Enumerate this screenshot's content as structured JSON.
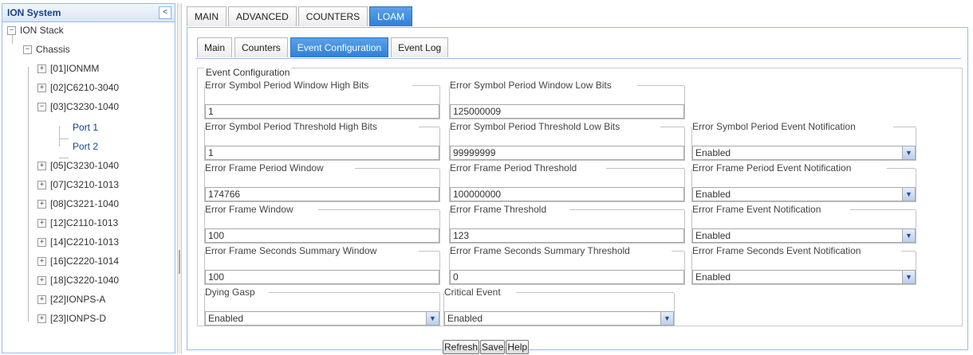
{
  "tree": {
    "title": "ION System",
    "collapse_icon": "<",
    "root": "ION Stack",
    "chassis": "Chassis",
    "items": [
      "[01]IONMM",
      "[02]C6210-3040",
      "[03]C3230-1040",
      "Port 1",
      "Port 2",
      "[05]C3230-1040",
      "[07]C3210-1013",
      "[08]C3221-1040",
      "[12]C2110-1013",
      "[14]C2210-1013",
      "[16]C2220-1014",
      "[18]C3220-1040",
      "[22]IONPS-A",
      "[23]IONPS-D"
    ],
    "expand_glyph": "+",
    "collapse_glyph": "−"
  },
  "main_tabs": [
    "MAIN",
    "ADVANCED",
    "COUNTERS",
    "LOAM"
  ],
  "sub_tabs": [
    "Main",
    "Counters",
    "Event Configuration",
    "Event Log"
  ],
  "event": {
    "legend": "Event Configuration",
    "fields": {
      "esp_window_high": {
        "label": "Error Symbol Period Window High Bits",
        "value": "1"
      },
      "esp_window_low": {
        "label": "Error Symbol Period Window Low Bits",
        "value": "125000009"
      },
      "esp_threshold_high": {
        "label": "Error Symbol Period Threshold High Bits",
        "value": "1"
      },
      "esp_threshold_low": {
        "label": "Error Symbol Period Threshold Low Bits",
        "value": "99999999"
      },
      "esp_notification": {
        "label": "Error Symbol Period Event Notification",
        "value": "Enabled"
      },
      "efp_window": {
        "label": "Error Frame Period Window",
        "value": "174766"
      },
      "efp_threshold": {
        "label": "Error Frame Period Threshold",
        "value": "100000000"
      },
      "efp_notification": {
        "label": "Error Frame Period Event Notification",
        "value": "Enabled"
      },
      "ef_window": {
        "label": "Error Frame Window",
        "value": "100"
      },
      "ef_threshold": {
        "label": "Error Frame Threshold",
        "value": "123"
      },
      "ef_notification": {
        "label": "Error Frame Event Notification",
        "value": "Enabled"
      },
      "efs_window": {
        "label": "Error Frame Seconds Summary Window",
        "value": "100"
      },
      "efs_threshold": {
        "label": "Error Frame Seconds Summary Threshold",
        "value": "0"
      },
      "efs_notification": {
        "label": "Error Frame Seconds Event Notification",
        "value": "Enabled"
      },
      "dying_gasp": {
        "label": "Dying Gasp",
        "value": "Enabled"
      },
      "critical_event": {
        "label": "Critical Event",
        "value": "Enabled"
      }
    }
  },
  "buttons": {
    "refresh": "Refresh",
    "save": "Save",
    "help": "Help"
  },
  "colors": {
    "accent": "#2f7ed8",
    "border": "#99bbe8"
  }
}
